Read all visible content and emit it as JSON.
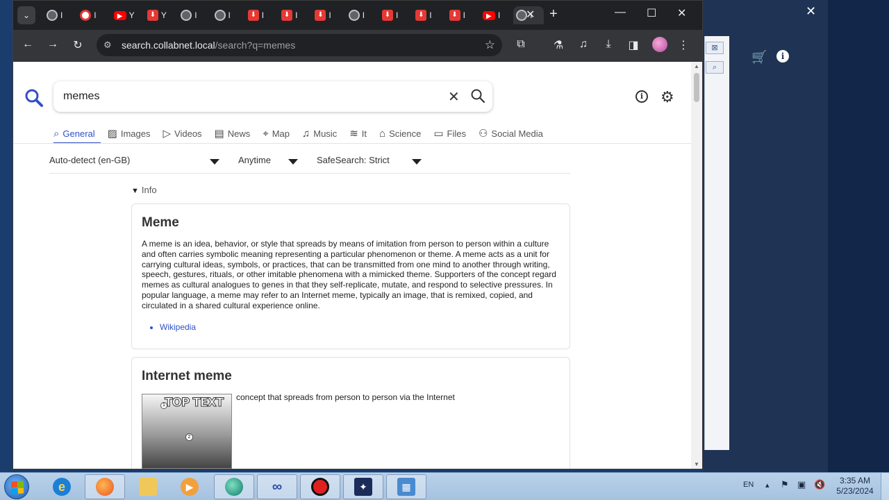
{
  "browser": {
    "tabs": [
      {
        "icon": "globe-icon",
        "title": "I"
      },
      {
        "icon": "record-icon",
        "title": "I"
      },
      {
        "icon": "youtube-icon",
        "title": "Y"
      },
      {
        "icon": "download-icon",
        "title": "Y"
      },
      {
        "icon": "globe-icon",
        "title": "I"
      },
      {
        "icon": "globe-icon",
        "title": "I"
      },
      {
        "icon": "download-icon",
        "title": "I"
      },
      {
        "icon": "download-icon",
        "title": "I"
      },
      {
        "icon": "download-icon",
        "title": "I"
      },
      {
        "icon": "globe-icon",
        "title": "I"
      },
      {
        "icon": "download-icon",
        "title": "I"
      },
      {
        "icon": "download-icon",
        "title": "I"
      },
      {
        "icon": "download-icon",
        "title": "I"
      },
      {
        "icon": "youtube-icon",
        "title": "I"
      },
      {
        "icon": "globe-icon",
        "title": "I",
        "active": true
      }
    ],
    "url_host": "search.collabnet.local",
    "url_path": "/search?q=memes"
  },
  "search": {
    "query": "memes",
    "categories": [
      {
        "icon": "search-icon",
        "label": "General",
        "active": true
      },
      {
        "icon": "image-icon",
        "label": "Images"
      },
      {
        "icon": "play-icon",
        "label": "Videos"
      },
      {
        "icon": "news-icon",
        "label": "News"
      },
      {
        "icon": "map-pin-icon",
        "label": "Map"
      },
      {
        "icon": "music-icon",
        "label": "Music"
      },
      {
        "icon": "layers-icon",
        "label": "It"
      },
      {
        "icon": "graduation-icon",
        "label": "Science"
      },
      {
        "icon": "files-icon",
        "label": "Files"
      },
      {
        "icon": "people-icon",
        "label": "Social Media"
      }
    ],
    "filters": {
      "language": "Auto-detect (en-GB)",
      "time": "Anytime",
      "safesearch": "SafeSearch: Strict"
    },
    "info_toggle": "Info"
  },
  "results": {
    "meme": {
      "title": "Meme",
      "description": "A meme is an idea, behavior, or style that spreads by means of imitation from person to person within a culture and often carries symbolic meaning representing a particular phenomenon or theme. A meme acts as a unit for carrying cultural ideas, symbols, or practices, that can be transmitted from one mind to another through writing, speech, gestures, rituals, or other imitable phenomena with a mimicked theme. Supporters of the concept regard memes as cultural analogues to genes in that they self-replicate, mutate, and respond to selective pressures. In popular language, a meme may refer to an Internet meme, typically an image, that is remixed, copied, and circulated in a shared cultural experience online.",
      "link": "Wikipedia"
    },
    "internet_meme": {
      "title": "Internet meme",
      "image_text": "TOP TEXT",
      "image_marker_1": "1",
      "image_marker_2": "2",
      "description": "concept that spreads from person to person via the Internet"
    }
  },
  "taskbar": {
    "language": "EN",
    "time": "3:35 AM",
    "date": "5/23/2024"
  },
  "colors": {
    "accent": "#3050c8",
    "chrome_dark": "#202124",
    "taskbar": "#a6c2e0"
  }
}
